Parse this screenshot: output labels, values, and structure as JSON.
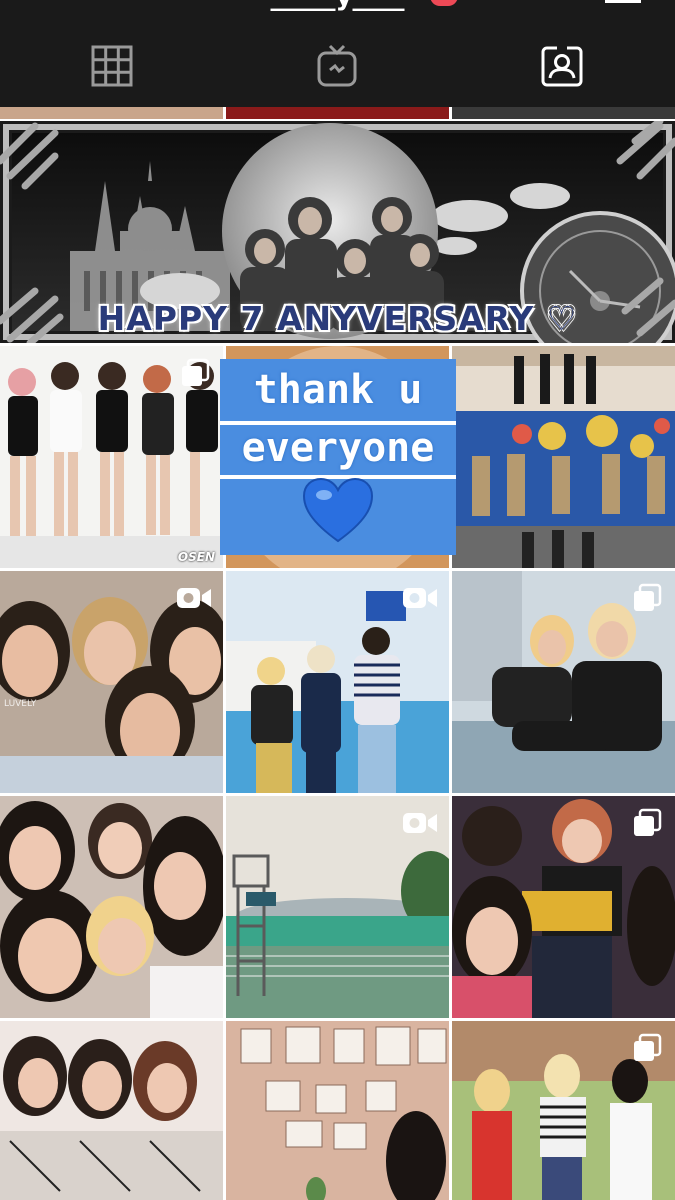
{
  "header": {
    "username": "_____y____ ",
    "tabs": [
      {
        "name": "grid",
        "icon": "grid-icon",
        "active": true
      },
      {
        "name": "igtv",
        "icon": "igtv-icon",
        "active": false
      },
      {
        "name": "tagged",
        "icon": "tagged-person-icon",
        "active": false
      }
    ]
  },
  "banner": {
    "caption": "HAPPY 7 ANYVERSARY ♡"
  },
  "overlay": {
    "line1": "thank u",
    "line2": "everyone",
    "emoji": "blue-heart-emoji"
  },
  "posts": [
    {
      "type": "photo",
      "watermark": "OSEN",
      "icon": "none"
    },
    {
      "type": "photo",
      "icon": "none"
    },
    {
      "type": "photo",
      "icon": "none"
    },
    {
      "type": "video",
      "icon": "video-camera-icon",
      "watermark": "LUVELY"
    },
    {
      "type": "video",
      "icon": "video-camera-icon"
    },
    {
      "type": "carousel",
      "icon": "carousel-icon"
    },
    {
      "type": "photo",
      "icon": "none"
    },
    {
      "type": "video",
      "icon": "video-camera-icon"
    },
    {
      "type": "carousel",
      "icon": "carousel-icon"
    },
    {
      "type": "photo",
      "icon": "none"
    },
    {
      "type": "photo",
      "icon": "none"
    },
    {
      "type": "carousel",
      "icon": "carousel-icon"
    }
  ],
  "photo_watermarks": {
    "osen": "OSEN",
    "luvely": "LUVELY"
  },
  "colors": {
    "header_bg": "#1a1a1a",
    "overlay_blue": "#4a8de0",
    "banner_text": "#2a3b7a",
    "notification": "#ed4956"
  }
}
